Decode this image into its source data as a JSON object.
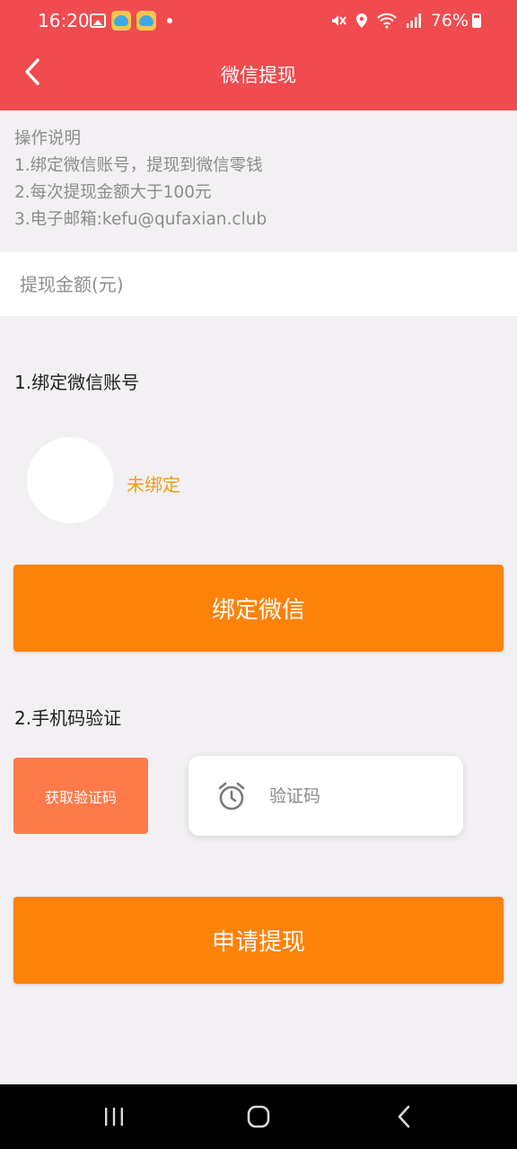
{
  "status_bar": {
    "time": "16:20",
    "battery": "76%"
  },
  "header": {
    "title": "微信提现"
  },
  "instructions": {
    "heading": "操作说明",
    "line1": "1.绑定微信账号，提现到微信零钱",
    "line2": "2.每次提现金额大于100元",
    "line3": "3.电子邮箱:kefu@qufaxian.club"
  },
  "amount": {
    "placeholder": "提现金额(元)"
  },
  "bind_section": {
    "title": "1.绑定微信账号",
    "status": "未绑定",
    "button_label": "绑定微信"
  },
  "verify_section": {
    "title": "2.手机码验证",
    "get_code_label": "获取验证码",
    "code_placeholder": "验证码"
  },
  "submit": {
    "label": "申请提现"
  },
  "colors": {
    "header": "#f04b4f",
    "primary_button": "#ff8209",
    "code_button": "#ff7a4a",
    "status_text": "#f39c12"
  }
}
